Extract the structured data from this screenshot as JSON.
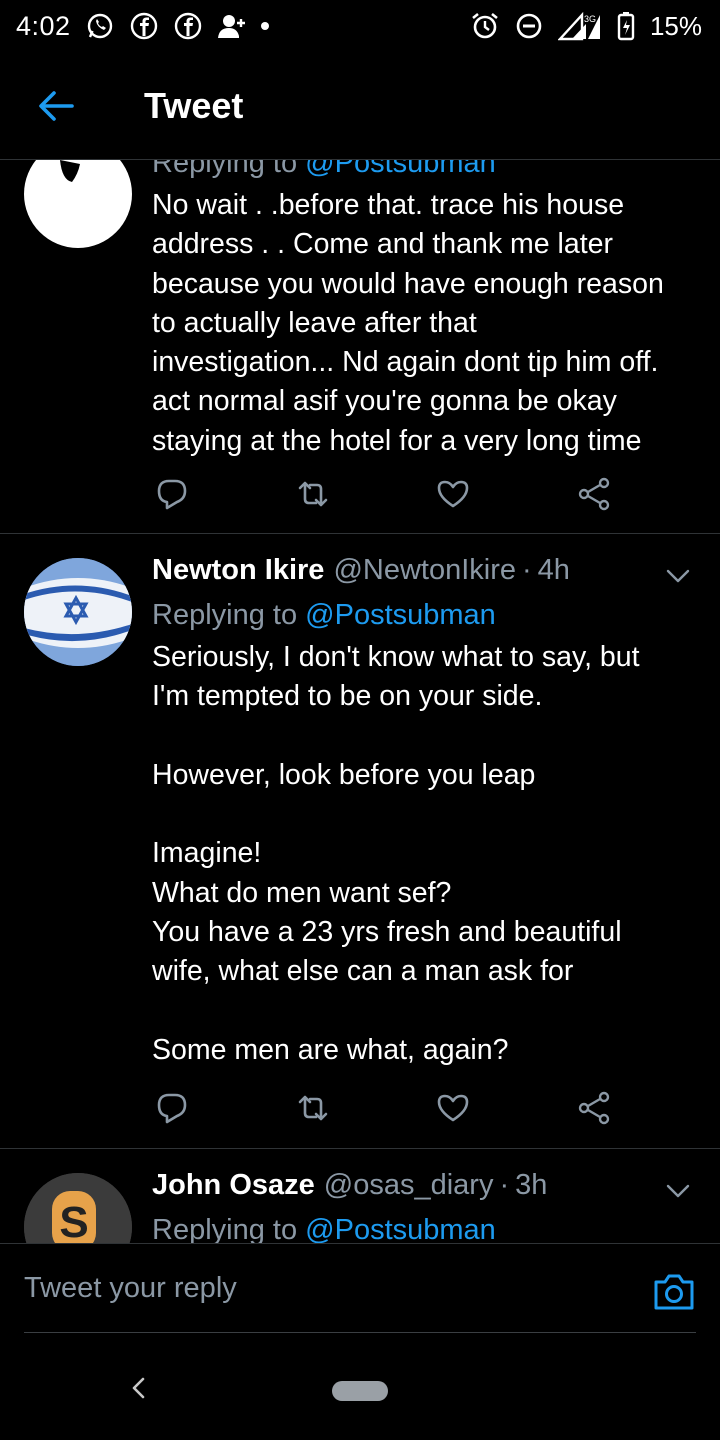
{
  "status_bar": {
    "time": "4:02",
    "network": "3G",
    "battery": "15%",
    "icons": [
      "whatsapp-icon",
      "facebook-icon",
      "facebook-icon",
      "add-user-icon",
      "alarm-icon",
      "do-not-disturb-icon",
      "signal-icon",
      "battery-icon"
    ]
  },
  "header": {
    "title": "Tweet",
    "back_icon": "arrow-left-icon",
    "accent_color": "#1d9bf0"
  },
  "tweets": [
    {
      "replying_prefix": "Replying to",
      "replying_to": "@Postsubman",
      "body": "No wait . .before that. trace his house\naddress . .  Come and thank me later\nbecause you would have enough reason\nto actually leave after that\ninvestigation... Nd again dont tip him off.\nact normal asif you're gonna be okay\nstaying at the hotel for a very long time"
    },
    {
      "name": "Newton Ikire",
      "handle": "@NewtonIkire",
      "separator": "·",
      "time": "4h",
      "replying_prefix": "Replying to",
      "replying_to": "@Postsubman",
      "body": "Seriously,  I don't know what to say, but\nI'm tempted to be on your side.\n\nHowever,  look before you leap\n\nImagine!\nWhat do men want sef?\nYou have a 23 yrs fresh and beautiful\nwife, what else can a man ask for\n\nSome men are what, again?"
    },
    {
      "name": "John Osaze",
      "handle": "@osas_diary",
      "separator": "·",
      "time": "3h",
      "replying_prefix": "Replying to",
      "replying_to": "@Postsubman"
    }
  ],
  "composer": {
    "placeholder": "Tweet your reply",
    "camera_icon": "camera-icon"
  },
  "nav_bar": {
    "back_icon": "nav-back-icon",
    "home_icon": "nav-home-pill"
  }
}
